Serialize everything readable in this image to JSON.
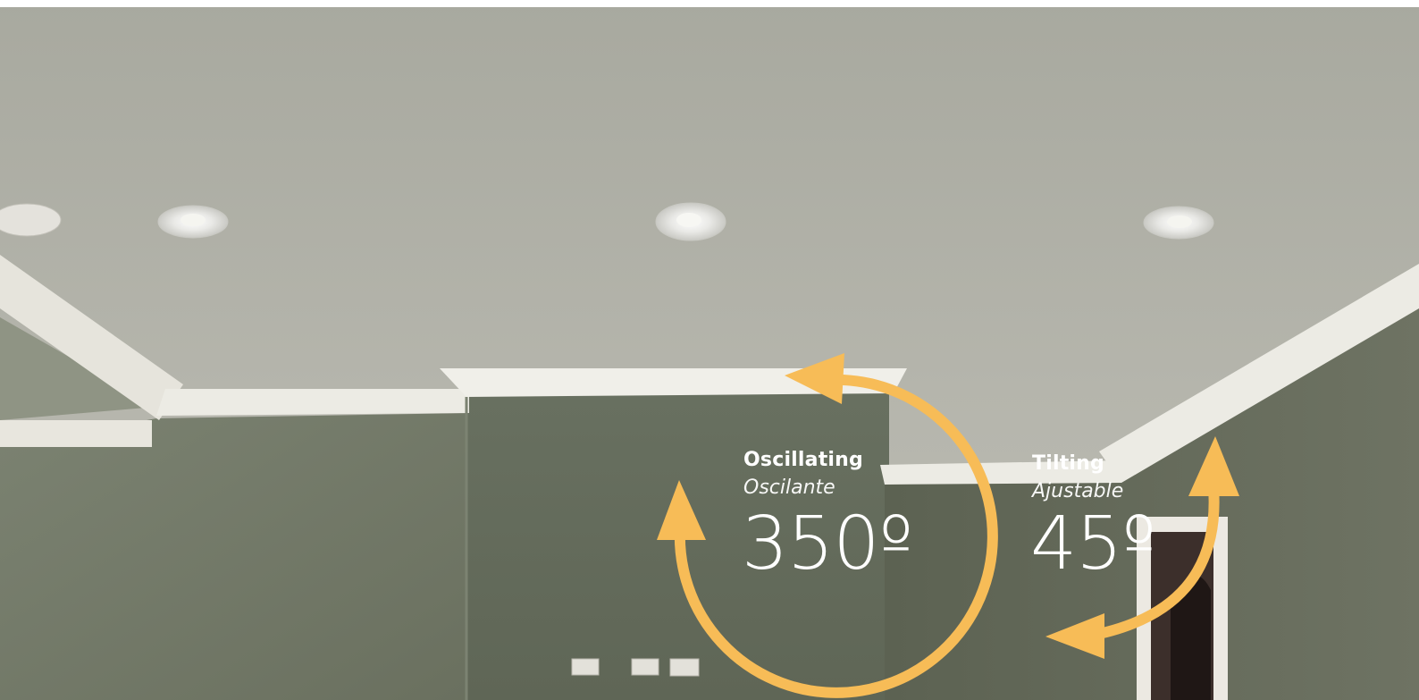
{
  "oscillating": {
    "label_en": "Oscillating",
    "label_es": "Oscilante",
    "value": "350º"
  },
  "tilting": {
    "label_en": "Tilting",
    "label_es": "Ajustable",
    "value": "45º"
  },
  "colors": {
    "arrow": "#f7bc57",
    "ceiling": "#b3b3a8",
    "wall": "#6e7564",
    "trim": "#eeeeea",
    "text": "#ffffff"
  },
  "icons": [
    "recessed-light-icon",
    "smoke-detector-icon",
    "rotation-arrow-icon",
    "tilt-arrow-icon",
    "wall-outlet-icon"
  ]
}
